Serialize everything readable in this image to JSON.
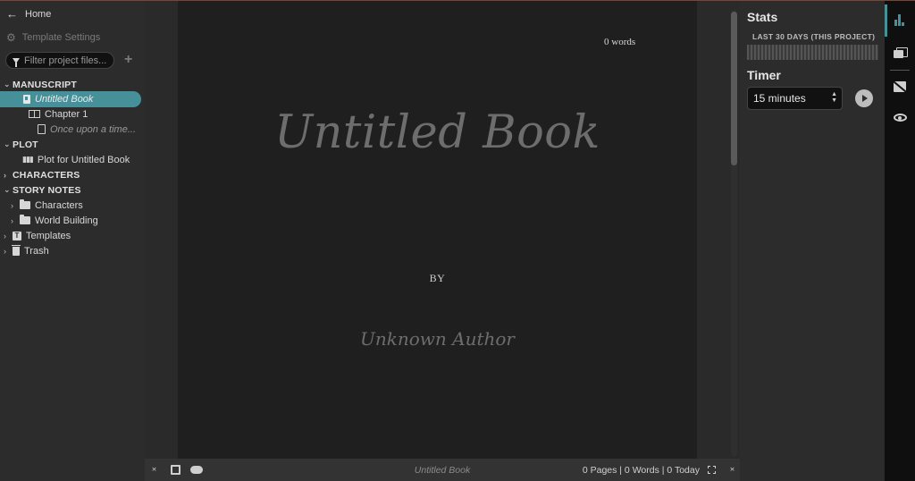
{
  "sidebar": {
    "home_label": "Home",
    "settings_label": "Template Settings",
    "filter_placeholder": "Filter project files...",
    "add_symbol": "+",
    "sections": {
      "manuscript": "MANUSCRIPT",
      "plot": "PLOT",
      "characters": "CHARACTERS",
      "story_notes": "STORY NOTES"
    },
    "items": {
      "book": "Untitled Book",
      "chapter": "Chapter 1",
      "scene": "Once upon a time...",
      "plot_item": "Plot for Untitled Book",
      "characters_folder": "Characters",
      "world_building_folder": "World Building",
      "templates": "Templates",
      "trash": "Trash"
    }
  },
  "editor": {
    "word_count": "0 words",
    "title": "Untitled Book",
    "by": "BY",
    "author": "Unknown Author"
  },
  "bottombar": {
    "doc_title": "Untitled Book",
    "stats": "0 Pages | 0 Words | 0 Today"
  },
  "rightpanel": {
    "stats_heading": "Stats",
    "stats_sub": "LAST 30 DAYS (THIS PROJECT)",
    "timer_heading": "Timer",
    "timer_value": "15 minutes"
  },
  "colors": {
    "accent": "#46909a",
    "background": "#1e1e1e",
    "sidebar": "#2c2c2c"
  }
}
